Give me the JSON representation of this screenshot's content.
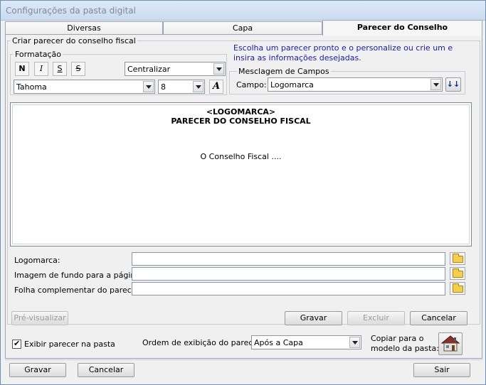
{
  "window": {
    "title": "Configurações da pasta digital"
  },
  "tabs": [
    {
      "label": "Diversas"
    },
    {
      "label": "Capa"
    },
    {
      "label": "Parecer do Conselho"
    }
  ],
  "criar_group": {
    "title": "Criar parecer do conselho fiscal"
  },
  "formatacao": {
    "title": "Formatação",
    "bold": "N",
    "italic": "I",
    "underline": "S",
    "strike": "S",
    "alignment": "Centralizar",
    "font": "Tahoma",
    "size": "8",
    "color_button": "A"
  },
  "info": "Escolha um parecer pronto e o personalize ou crie um e insira as informações desejadas.",
  "mesclagem": {
    "title": "Mesclagem de Campos",
    "campo_label": "Campo:",
    "campo_value": "Logomarca",
    "insert_button": "↓↓"
  },
  "editor": {
    "line1": "<LOGOMARCA>",
    "line2": "PARECER DO CONSELHO FISCAL",
    "body": "O Conselho Fiscal ...."
  },
  "fields": {
    "logomarca_label": "Logomarca:",
    "fundo_label": "Imagem de fundo para a página:",
    "folha_label": "Folha complementar do parecer:"
  },
  "actions": {
    "preview": "Pré-visualizar",
    "gravar": "Gravar",
    "excluir": "Excluir",
    "cancelar": "Cancelar"
  },
  "options": {
    "exibir_label": "Exibir parecer na pasta",
    "exibir_checked": true,
    "ordem_label": "Ordem de exibição do parecer:",
    "ordem_value": "Após a Capa",
    "copiar_label_1": "Copiar para o",
    "copiar_label_2": "modelo da pasta:"
  },
  "footer": {
    "gravar": "Gravar",
    "cancelar": "Cancelar",
    "sair": "Sair"
  }
}
